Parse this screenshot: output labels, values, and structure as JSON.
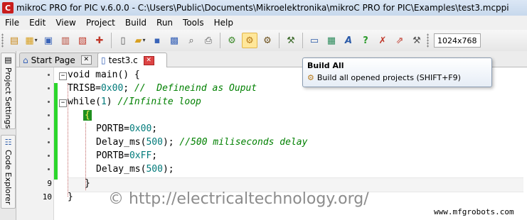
{
  "window": {
    "title": "mikroC PRO for PIC v.6.0.0 - C:\\Users\\Public\\Documents\\Mikroelektronika\\mikroC PRO for PIC\\Examples\\test3.mcppi",
    "app_icon_letter": "C"
  },
  "menu": [
    "File",
    "Edit",
    "View",
    "Project",
    "Build",
    "Run",
    "Tools",
    "Help"
  ],
  "toolbar": {
    "groups": [
      [
        "new-project-icon",
        "open-project-icon",
        "save-project-icon",
        "close-project-icon",
        "edit-project-icon",
        "add-file-icon"
      ],
      [
        "new-file-icon",
        "open-file-icon",
        "save-file-icon",
        "save-all-icon",
        "print-preview-icon",
        "print-icon"
      ],
      [
        "build-icon",
        "build-all-icon",
        "build-and-program-icon"
      ],
      [
        "programmer-icon"
      ],
      [
        "monitor-icon",
        "chip-icon",
        "font-icon",
        "help-icon",
        "compile-icon",
        "export-icon",
        "tools-icon"
      ]
    ],
    "resolution": "1024x768"
  },
  "sidebar": {
    "project_settings": "Project Settings",
    "code_explorer": "Code Explorer"
  },
  "tabs": [
    {
      "label": "Start Page",
      "active": false
    },
    {
      "label": "test3.c",
      "active": true
    }
  ],
  "editor": {
    "line_numbers": [
      "9",
      "10"
    ],
    "lines": {
      "l1": {
        "kw": "void main() {"
      },
      "l2": {
        "code": "TRISB=",
        "num": "0x00",
        "rest": "; ",
        "comment": "//  Defineind as Ouput"
      },
      "l3": {
        "code": "while(",
        "num": "1",
        "rest": ") ",
        "comment": "//Infinite loop"
      },
      "l4": {
        "brace": "{"
      },
      "l5": {
        "code": "PORTB=",
        "num": "0x00",
        "rest": ";"
      },
      "l6": {
        "code": "Delay_ms(",
        "num": "500",
        "rest": "); ",
        "comment": "//500 miliseconds delay"
      },
      "l7": {
        "code": "PORTB=",
        "num": "0xFF",
        "rest": ";"
      },
      "l8": {
        "code": "Delay_ms(",
        "num": "500",
        "rest": ");"
      },
      "l9": {
        "code": "}"
      },
      "l10": {
        "code": "}"
      }
    }
  },
  "tooltip": {
    "title": "Build All",
    "description": "Build all opened projects (SHIFT+F9)"
  },
  "watermark": "© http://electricaltechnology.org/",
  "site": "www.mfgrobots.com",
  "colors": {
    "change_bar": "#2bd62b",
    "comment": "#008000",
    "number": "#007a7a"
  }
}
